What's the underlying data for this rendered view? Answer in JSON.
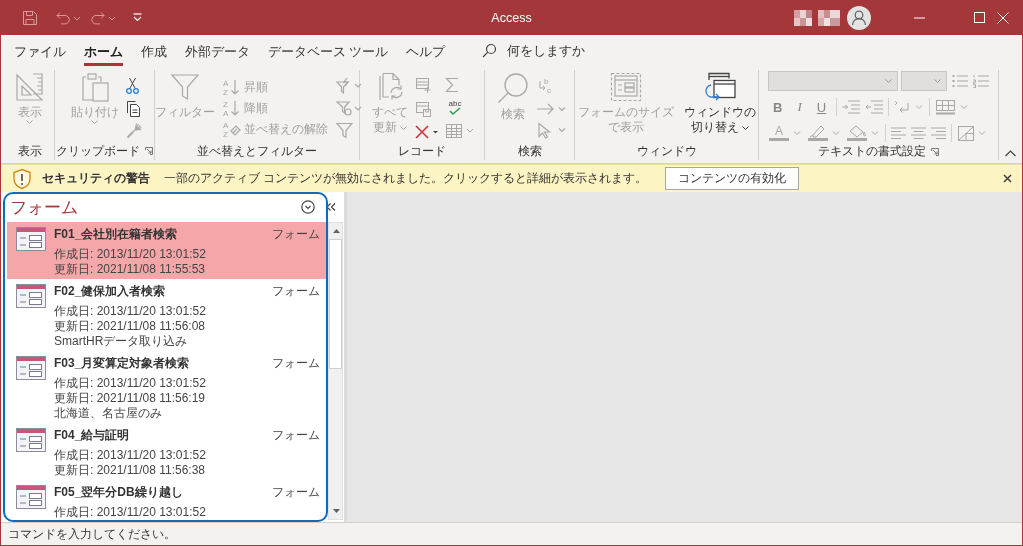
{
  "window": {
    "title": "Access"
  },
  "tabs": [
    {
      "label": "ファイル",
      "selected": false
    },
    {
      "label": "ホーム",
      "selected": true
    },
    {
      "label": "作成",
      "selected": false
    },
    {
      "label": "外部データ",
      "selected": false
    },
    {
      "label": "データベース ツール",
      "selected": false
    },
    {
      "label": "ヘルプ",
      "selected": false
    }
  ],
  "tell_me": {
    "placeholder": "何をしますか"
  },
  "ribbon": {
    "groups": [
      {
        "kind": "view",
        "label": "表示",
        "buttons": [
          {
            "label": "表示",
            "disabled": true
          }
        ]
      },
      {
        "kind": "clipboard",
        "label": "クリップボード",
        "buttons": [
          {
            "label": "貼り付け",
            "disabled": true
          }
        ]
      },
      {
        "kind": "sort_filter",
        "label": "並べ替えとフィルター",
        "buttons": [
          {
            "label": "フィルター",
            "disabled": true
          },
          {
            "label": "昇順",
            "icon_text": [
              "A",
              "Z"
            ],
            "disabled": true
          },
          {
            "label": "降順",
            "icon_text": [
              "Z",
              "A"
            ],
            "disabled": true
          },
          {
            "label": "並べ替えの解除",
            "icon_text": [
              "A",
              "Z"
            ],
            "disabled": true
          }
        ]
      },
      {
        "kind": "records",
        "label": "レコード",
        "buttons": [
          {
            "lines": [
              "すべて",
              "更新"
            ],
            "disabled": true
          }
        ],
        "spelling_icon_text": "abc"
      },
      {
        "kind": "find",
        "label": "検索",
        "buttons": [
          {
            "label": "検索",
            "disabled": true
          }
        ],
        "replace_icon_text": [
          "b",
          "c"
        ]
      },
      {
        "kind": "window",
        "label": "ウィンドウ",
        "buttons": [
          {
            "lines": [
              "フォームのサイズ",
              "で表示"
            ],
            "disabled": true
          },
          {
            "lines": [
              "ウィンドウの",
              "切り替え"
            ],
            "disabled": false
          }
        ]
      },
      {
        "kind": "text_format",
        "label": "テキストの書式設定",
        "style_buttons": [
          {
            "kind": "bold",
            "label": "B"
          },
          {
            "kind": "italic",
            "label": "I"
          },
          {
            "kind": "underline",
            "label": "U"
          }
        ],
        "font_color_icon_text": "A"
      }
    ]
  },
  "security_bar": {
    "title": "セキュリティの警告",
    "message": "一部のアクティブ コンテンツが無効にされました。クリックすると詳細が表示されます。",
    "button": "コンテンツの有効化"
  },
  "nav_pane": {
    "title": "フォーム",
    "items": [
      {
        "name": "F01_会社別在籍者検索",
        "type": "フォーム",
        "details": [
          "作成日: 2013/11/20 13:01:52",
          "更新日: 2021/11/08 11:55:53"
        ],
        "selected": true
      },
      {
        "name": "F02_健保加入者検索",
        "type": "フォーム",
        "details": [
          "作成日: 2013/11/20 13:01:52",
          "更新日: 2021/11/08 11:56:08",
          "SmartHRデータ取り込み"
        ],
        "selected": false
      },
      {
        "name": "F03_月変算定対象者検索",
        "type": "フォーム",
        "details": [
          "作成日: 2013/11/20 13:01:52",
          "更新日: 2021/11/08 11:56:19",
          "北海道、名古屋のみ"
        ],
        "selected": false
      },
      {
        "name": "F04_給与証明",
        "type": "フォーム",
        "details": [
          "作成日: 2013/11/20 13:01:52",
          "更新日: 2021/11/08 11:56:38"
        ],
        "selected": false
      },
      {
        "name": "F05_翌年分DB繰り越し",
        "type": "フォーム",
        "details": [
          "作成日: 2013/11/20 13:01:52"
        ],
        "selected": false
      }
    ]
  },
  "status_bar": {
    "text": "コマンドを入力してください。"
  }
}
